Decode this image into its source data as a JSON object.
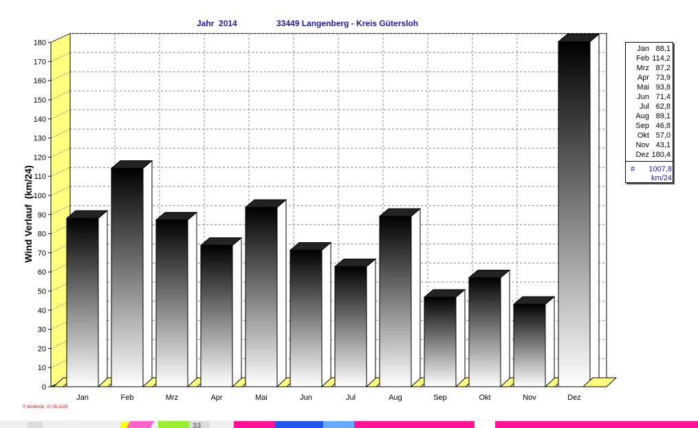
{
  "header": {
    "year_label": "Jahr  2014",
    "station_label": "33449 Langenberg - Kreis Gütersloh"
  },
  "chart_data": {
    "type": "bar",
    "title": "Jahr  2014    33449 Langenberg - Kreis Gütersloh",
    "ylabel": "Wind Verlauf  (km/24)",
    "xlabel": "",
    "categories": [
      "Jan",
      "Feb",
      "Mrz",
      "Apr",
      "Mai",
      "Jun",
      "Jul",
      "Aug",
      "Sep",
      "Okt",
      "Nov",
      "Dez"
    ],
    "values": [
      88.1,
      114.2,
      87.2,
      73.9,
      93.8,
      71.4,
      62.8,
      89.1,
      46.8,
      57.0,
      43.1,
      180.4
    ],
    "ylim": [
      0,
      180
    ],
    "yticks": [
      0,
      10,
      20,
      30,
      40,
      50,
      60,
      70,
      80,
      90,
      100,
      110,
      120,
      130,
      140,
      150,
      160,
      170,
      180
    ],
    "grid": true,
    "legend_position": "right"
  },
  "legend": {
    "rows": [
      {
        "month": "Jan",
        "value": "88,1"
      },
      {
        "month": "Feb",
        "value": "114,2"
      },
      {
        "month": "Mrz",
        "value": "87,2"
      },
      {
        "month": "Apr",
        "value": "73,9"
      },
      {
        "month": "Mai",
        "value": "93,8"
      },
      {
        "month": "Jun",
        "value": "71,4"
      },
      {
        "month": "Jul",
        "value": "62,8"
      },
      {
        "month": "Aug",
        "value": "89,1"
      },
      {
        "month": "Sep",
        "value": "46,8"
      },
      {
        "month": "Okt",
        "value": "57,0"
      },
      {
        "month": "Nov",
        "value": "43,1"
      },
      {
        "month": "Dez",
        "value": "180,4"
      }
    ],
    "total_symbol": "#",
    "total_value": "1007,8",
    "total_unit": "km/24"
  },
  "footer": {
    "credit": "© WsWin32  07.05.2025"
  },
  "taskbar": {
    "partial_text": "33"
  },
  "colors": {
    "title": "#1a1aa8",
    "side_wall": "#ffff80",
    "bar_top": "#000000",
    "bar_bottom": "#ffffff",
    "footer": "#d00000"
  }
}
